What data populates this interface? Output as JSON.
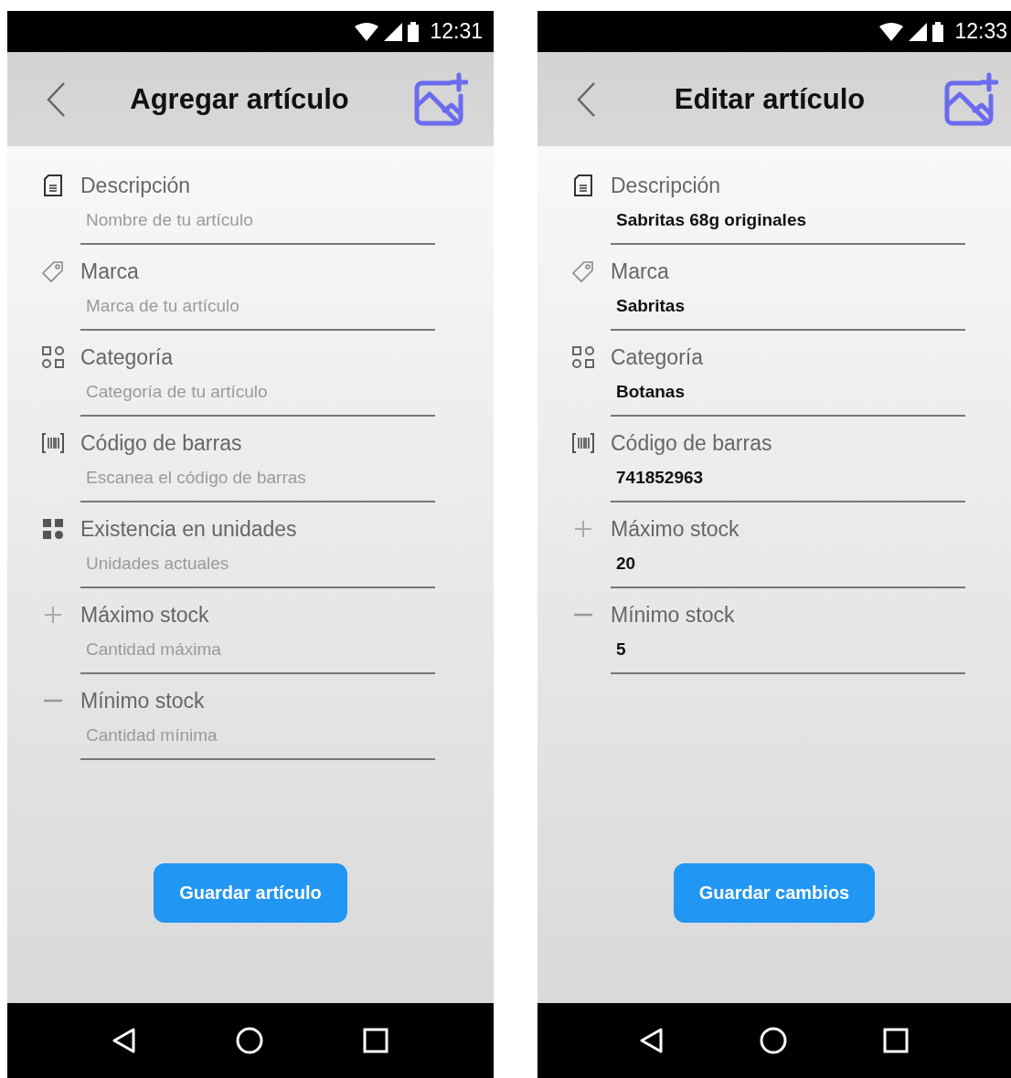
{
  "screens": [
    {
      "status_time": "12:31",
      "title": "Agregar artículo",
      "fields": [
        {
          "kind": "document",
          "label": "Descripción",
          "placeholder": "Nombre de tu artículo"
        },
        {
          "kind": "tag",
          "label": "Marca",
          "placeholder": "Marca de tu artículo"
        },
        {
          "kind": "grid",
          "label": "Categoría",
          "placeholder": "Categoría de tu artículo"
        },
        {
          "kind": "barcode",
          "label": "Código de barras",
          "placeholder": "Escanea el código de barras"
        },
        {
          "kind": "blocks",
          "label": "Existencia en unidades",
          "placeholder": "Unidades actuales"
        },
        {
          "kind": "plus",
          "label": "Máximo stock",
          "placeholder": "Cantidad máxima"
        },
        {
          "kind": "minus",
          "label": "Mínimo stock",
          "placeholder": "Cantidad mínima"
        }
      ],
      "button": "Guardar artículo"
    },
    {
      "status_time": "12:33",
      "title": "Editar artículo",
      "fields": [
        {
          "kind": "document",
          "label": "Descripción",
          "value": "Sabritas 68g originales"
        },
        {
          "kind": "tag",
          "label": "Marca",
          "value": "Sabritas"
        },
        {
          "kind": "grid",
          "label": "Categoría",
          "value": "Botanas"
        },
        {
          "kind": "barcode",
          "label": "Código de barras",
          "value": "741852963"
        },
        {
          "kind": "plus",
          "label": "Máximo stock",
          "value": "20"
        },
        {
          "kind": "minus",
          "label": "Mínimo stock",
          "value": "5"
        }
      ],
      "button": "Guardar cambios"
    }
  ]
}
